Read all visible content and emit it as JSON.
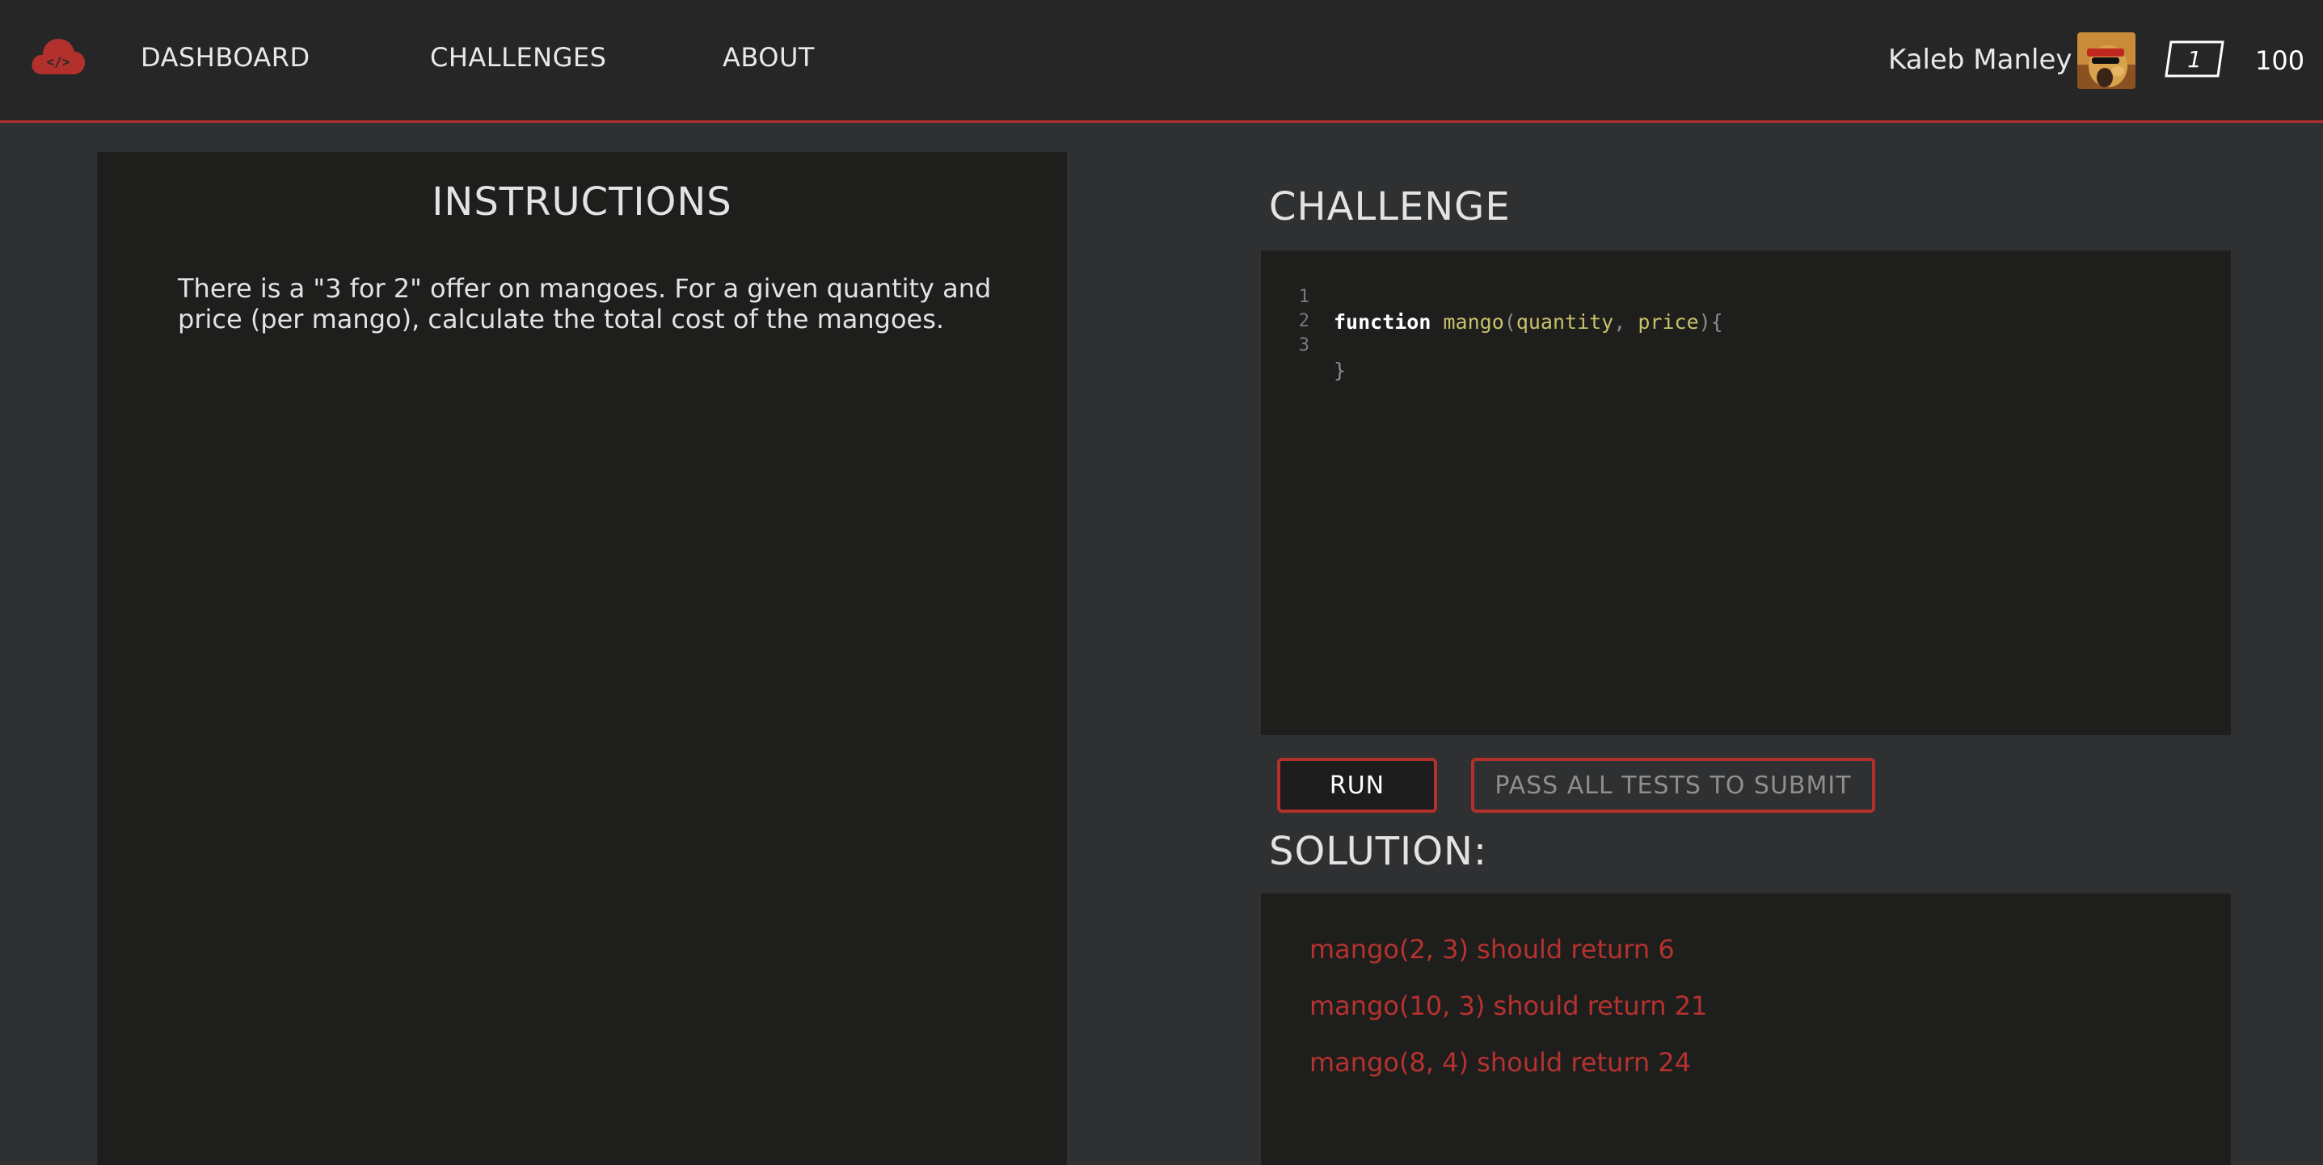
{
  "nav": {
    "logo_icon": "cloud-code-icon",
    "links": [
      "DASHBOARD",
      "CHALLENGES",
      "ABOUT"
    ]
  },
  "user": {
    "name": "Kaleb Manley",
    "level": "1",
    "points": "100"
  },
  "instructions": {
    "title": "INSTRUCTIONS",
    "text": "There is a \"3 for 2\" offer on mangoes. For a given quantity and price (per mango), calculate the total cost of the mangoes."
  },
  "challenge": {
    "title": "CHALLENGE",
    "code": {
      "line_numbers": [
        "1",
        "2",
        "3"
      ],
      "line1": {
        "keyword": "function",
        "name": "mango",
        "open": "(",
        "param1": "quantity",
        "comma": ",",
        "param2": "price",
        "close": "){"
      },
      "line3": "}"
    },
    "run_label": "RUN",
    "submit_label": "PASS ALL TESTS TO SUBMIT"
  },
  "solution": {
    "title": "SOLUTION:",
    "tests": [
      "mango(2, 3) should return 6",
      "mango(10, 3) should return 21",
      "mango(8, 4) should return 24"
    ]
  },
  "colors": {
    "accent": "#b2312d",
    "header_bg": "#262627",
    "page_bg": "#2f3032",
    "panel_bg": "#1e1e1d",
    "test_text": "#b5322e"
  }
}
